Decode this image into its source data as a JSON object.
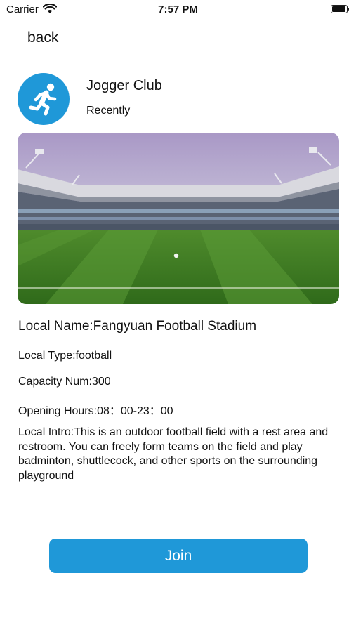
{
  "status_bar": {
    "carrier": "Carrier",
    "time": "7:57 PM"
  },
  "nav": {
    "back_label": "back"
  },
  "club": {
    "name": "Jogger Club",
    "subtitle": "Recently",
    "avatar_icon": "running-person-icon"
  },
  "venue": {
    "photo": "football-stadium-photo",
    "name_line": "Local Name:Fangyuan Football Stadium",
    "type_line": "Local Type:football",
    "capacity_line": "Capacity Num:300",
    "hours_line": "Opening Hours:08：00-23：00",
    "intro_line": "Local Intro:This is an outdoor football field with a rest area and restroom. You can freely form teams on the field and play badminton, shuttlecock, and other sports on the surrounding playground"
  },
  "actions": {
    "join_label": "Join"
  },
  "colors": {
    "accent": "#1f98d8"
  }
}
